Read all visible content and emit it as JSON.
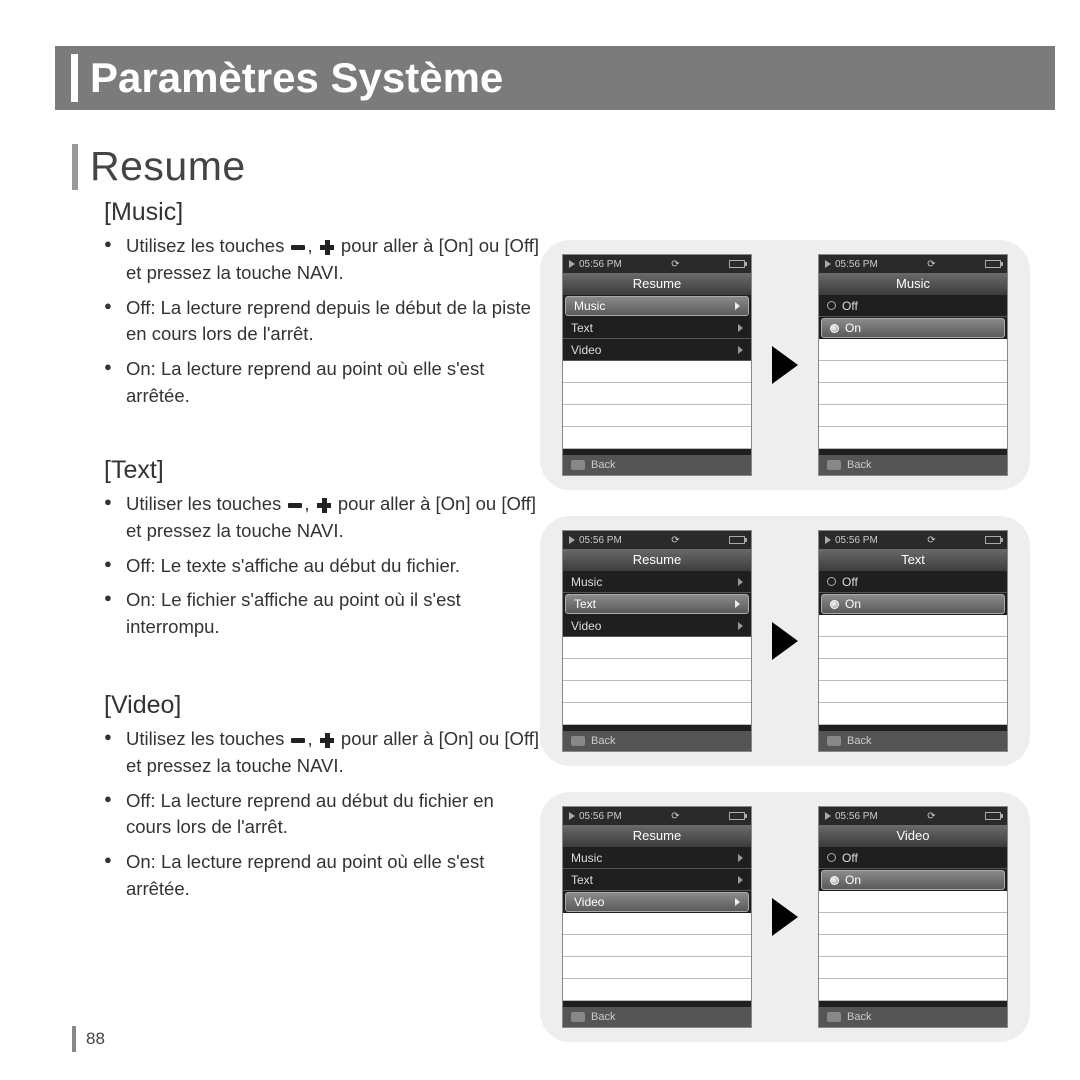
{
  "header": {
    "title": "Paramètres Système"
  },
  "section": {
    "title": "Resume"
  },
  "subsections": [
    {
      "label": "[Music]",
      "bullets": [
        "Utilisez les touches [minus], [plus] pour aller à [On] ou [Off] et pressez la touche NAVI.",
        "Off: La lecture reprend depuis le début de la piste en cours lors de l'arrêt.",
        "On: La lecture reprend au point où elle s'est arrêtée."
      ]
    },
    {
      "label": "[Text]",
      "bullets": [
        "Utiliser les touches [minus], [plus] pour aller à [On] ou [Off] et pressez la touche NAVI.",
        "Off: Le texte s'affiche au début du fichier.",
        "On: Le fichier s'affiche au point où il s'est interrompu."
      ]
    },
    {
      "label": "[Video]",
      "bullets": [
        "Utilisez les touches [minus], [plus] pour aller à [On] ou [Off] et pressez la touche NAVI.",
        "Off: La lecture reprend au début du fichier en cours lors de l'arrêt.",
        "On: La lecture reprend au point où elle s'est arrêtée."
      ]
    }
  ],
  "device_common": {
    "time": "05:56 PM",
    "back": "Back"
  },
  "screens": {
    "resume": {
      "title": "Resume",
      "items": [
        "Music",
        "Text",
        "Video"
      ]
    },
    "music_options": {
      "title": "Music",
      "off": "Off",
      "on": "On"
    },
    "text_options": {
      "title": "Text",
      "off": "Off",
      "on": "On"
    },
    "video_options": {
      "title": "Video",
      "off": "Off",
      "on": "On"
    }
  },
  "page_number": "88"
}
